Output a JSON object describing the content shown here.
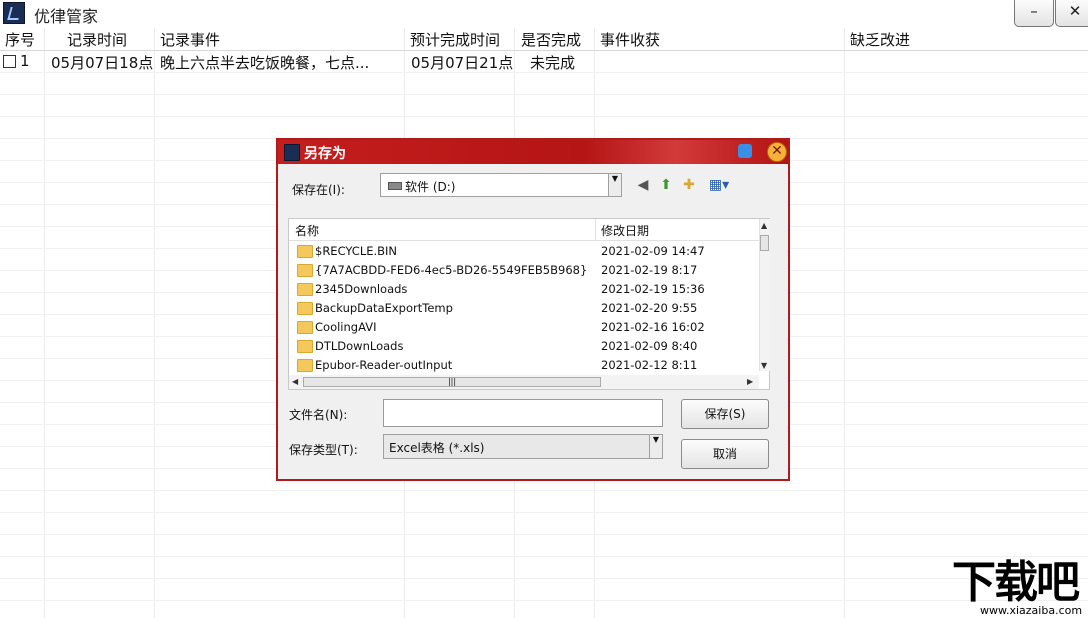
{
  "app": {
    "title": "优律管家",
    "min_symbol": "–",
    "close_symbol": "✕"
  },
  "grid": {
    "headers": [
      "序号",
      "记录时间",
      "记录事件",
      "预计完成时间",
      "是否完成",
      "事件收获",
      "缺乏改进"
    ],
    "rows": [
      {
        "index": "1",
        "record_time": "05月07日18点",
        "event": "晚上六点半去吃饭晚餐，七点...",
        "due_time": "05月07日21点",
        "done": "未完成",
        "gain": "",
        "improve": ""
      }
    ]
  },
  "dialog": {
    "title": "另存为",
    "save_in_label": "保存在(I):",
    "save_in_value": "软件 (D:)",
    "toolbar_icons": [
      "back-icon",
      "up-folder-icon",
      "new-folder-icon",
      "view-menu-icon"
    ],
    "columns": {
      "name": "名称",
      "modified": "修改日期"
    },
    "files": [
      {
        "name": "$RECYCLE.BIN",
        "date": "2021-02-09 14:47"
      },
      {
        "name": "{7A7ACBDD-FED6-4ec5-BD26-5549FEB5B968}",
        "date": "2021-02-19 8:17"
      },
      {
        "name": "2345Downloads",
        "date": "2021-02-19 15:36"
      },
      {
        "name": "BackupDataExportTemp",
        "date": "2021-02-20 9:55"
      },
      {
        "name": "CoolingAVI",
        "date": "2021-02-16 16:02"
      },
      {
        "name": "DTLDownLoads",
        "date": "2021-02-09 8:40"
      },
      {
        "name": "Epubor-Reader-outInput",
        "date": "2021-02-12 8:11"
      }
    ],
    "filename_label": "文件名(N):",
    "filename_value": "",
    "filetype_label": "保存类型(T):",
    "filetype_value": "Excel表格 (*.xls)",
    "save_button": "保存(S)",
    "cancel_button": "取消"
  },
  "watermark": {
    "main": "下载吧",
    "sub": "www.xiazaiba.com"
  }
}
